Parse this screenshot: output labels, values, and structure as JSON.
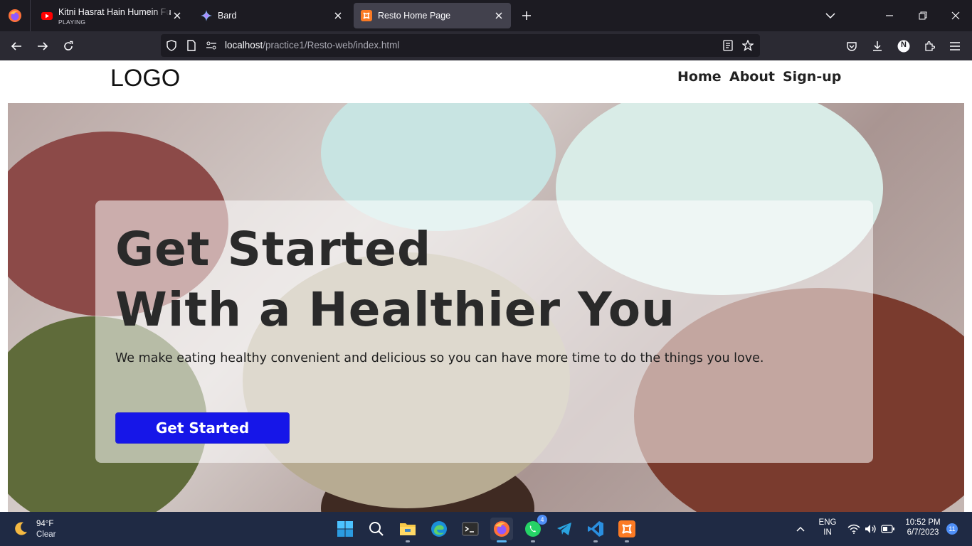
{
  "browser": {
    "tabs": [
      {
        "title": "Kitni Hasrat Hain Humein Full V",
        "subtitle": "PLAYING",
        "icon": "youtube-icon"
      },
      {
        "title": "Bard",
        "icon": "bard-sparkle-icon"
      },
      {
        "title": "Resto Home Page",
        "icon": "xampp-icon",
        "active": true
      }
    ],
    "url": {
      "host": "localhost",
      "path": "/practice1/Resto-web/index.html"
    },
    "profile_initial": "N"
  },
  "site": {
    "logo": "LOGO",
    "nav": [
      "Home",
      "About",
      "Sign-up"
    ],
    "hero": {
      "headline_line1": "Get Started",
      "headline_line2": "With a Healthier You",
      "tagline": "We make eating healthy convenient and delicious so you can have more time to do the things you love.",
      "cta_label": "Get Started"
    },
    "colors": {
      "cta": "#1616e8",
      "text": "#2a2a2a"
    }
  },
  "taskbar": {
    "weather": {
      "temp": "94°F",
      "condition": "Clear",
      "icon": "moon-icon"
    },
    "apps": [
      "windows-start-icon",
      "search-icon",
      "file-explorer-icon",
      "edge-icon",
      "terminal-icon",
      "firefox-icon",
      "whatsapp-icon",
      "telegram-icon",
      "vscode-icon",
      "xampp-icon"
    ],
    "whatsapp_badge": "4",
    "language": {
      "line1": "ENG",
      "line2": "IN"
    },
    "clock": {
      "time": "10:52 PM",
      "date": "6/7/2023"
    },
    "notifications": "11"
  }
}
